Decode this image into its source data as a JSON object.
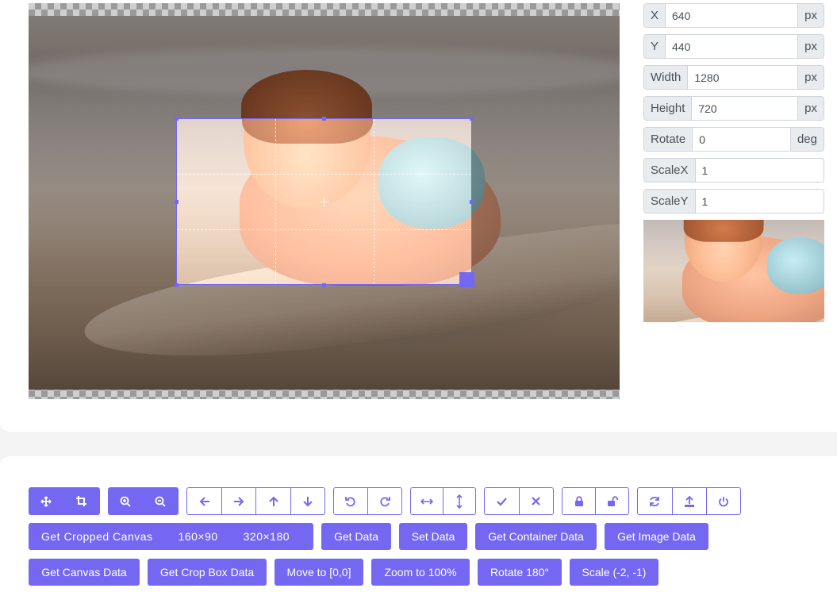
{
  "form": {
    "x": {
      "label": "X",
      "value": "640",
      "unit": "px"
    },
    "y": {
      "label": "Y",
      "value": "440",
      "unit": "px"
    },
    "width": {
      "label": "Width",
      "value": "1280",
      "unit": "px"
    },
    "height": {
      "label": "Height",
      "value": "720",
      "unit": "px"
    },
    "rotate": {
      "label": "Rotate",
      "value": "0",
      "unit": "deg"
    },
    "scaleX": {
      "label": "ScaleX",
      "value": "1"
    },
    "scaleY": {
      "label": "ScaleY",
      "value": "1"
    }
  },
  "toolbar": {
    "icons": [
      "move-icon",
      "crop-icon",
      "zoom-in-icon",
      "zoom-out-icon",
      "arrow-left-icon",
      "arrow-right-icon",
      "arrow-up-icon",
      "arrow-down-icon",
      "rotate-left-icon",
      "rotate-right-icon",
      "flip-horizontal-icon",
      "flip-vertical-icon",
      "check-icon",
      "times-icon",
      "lock-icon",
      "unlock-icon",
      "refresh-icon",
      "upload-icon",
      "power-icon"
    ]
  },
  "buttons": {
    "get_cropped_canvas": "Get Cropped Canvas",
    "size_160": "160×90",
    "size_320": "320×180",
    "get_data": "Get Data",
    "set_data": "Set Data",
    "get_container_data": "Get Container Data",
    "get_image_data": "Get Image Data",
    "get_canvas_data": "Get Canvas Data",
    "get_crop_box_data": "Get Crop Box Data",
    "move_to": "Move to [0,0]",
    "zoom_100": "Zoom to 100%",
    "rotate_180": "Rotate 180°",
    "scale": "Scale (-2, -1)"
  },
  "colors": {
    "accent": "#7468f2"
  }
}
